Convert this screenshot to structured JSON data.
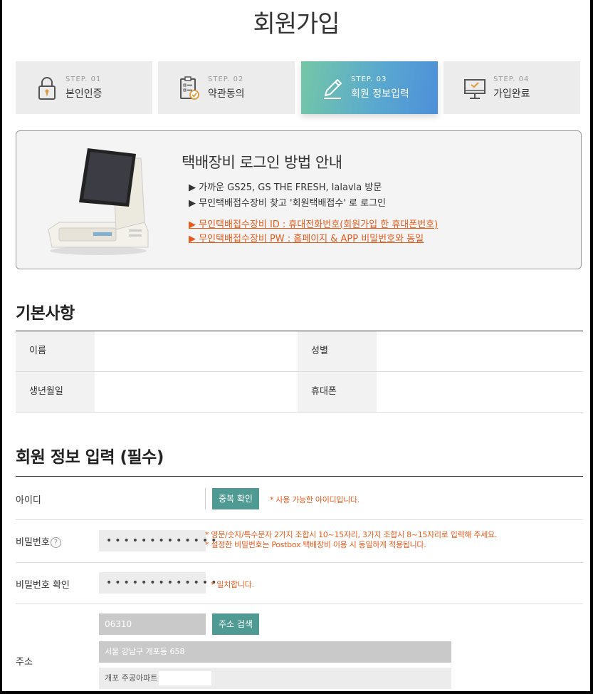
{
  "page": {
    "title": "회원가입"
  },
  "steps": [
    {
      "no": "STEP. 01",
      "name": "본인인증",
      "icon": "lock-icon",
      "active": false
    },
    {
      "no": "STEP. 02",
      "name": "약관동의",
      "icon": "checklist-icon",
      "active": false
    },
    {
      "no": "STEP. 03",
      "name": "회원 정보입력",
      "icon": "pencil-icon",
      "active": true
    },
    {
      "no": "STEP. 04",
      "name": "가입완료",
      "icon": "monitor-check-icon",
      "active": false
    }
  ],
  "notice": {
    "title": "택배장비 로그인 방법 안내",
    "lines": [
      "▶ 가까운 GS25, GS THE FRESH, lalavla 방문",
      "▶ 무인택배접수장비 찾고 '회원택배접수' 로 로그인"
    ],
    "links": [
      "▶ 무인택배접수장비 ID : 휴대전화번호(회원가입 한 휴대폰번호)",
      "▶ 무인택배접수장비 PW : 홈페이지 & APP 비밀번호와 동일"
    ]
  },
  "basic": {
    "title": "기본사항",
    "name_label": "이름",
    "gender_label": "성별",
    "birth_label": "생년월일",
    "phone_label": "휴대폰"
  },
  "form": {
    "title": "회원 정보 입력 (필수)",
    "id_label": "아이디",
    "dup_button": "중복 확인",
    "id_msg": "* 사용 가능한 아이디입니다.",
    "pw_label": "비밀번호",
    "pw_help": "?",
    "pw_value": "•••••••••••••",
    "pw_msg1": "* 영문/숫자/특수문자 2가지 조합시 10~15자리, 3가지 조합시 8~15자리로 입력해 주세요.",
    "pw_msg2": "* 설정한 비밀번호는 Postbox 택배장비 이용 시 동일하게 적용됩니다.",
    "pw_confirm_label": "비밀번호 확인",
    "pw_confirm_value": "•••••••••••••",
    "pw_confirm_msg": "* 일치합니다.",
    "addr_label": "주소",
    "zip": "06310",
    "addr_button": "주소 검색",
    "addr1": "서울 강남구 개포동 658",
    "addr2": "개포 주공아파트"
  },
  "colors": {
    "accent": "#4f9b94",
    "warning": "#e85b1c",
    "step_gradient_start": "#74c7a6",
    "step_gradient_end": "#4d8fd9"
  }
}
